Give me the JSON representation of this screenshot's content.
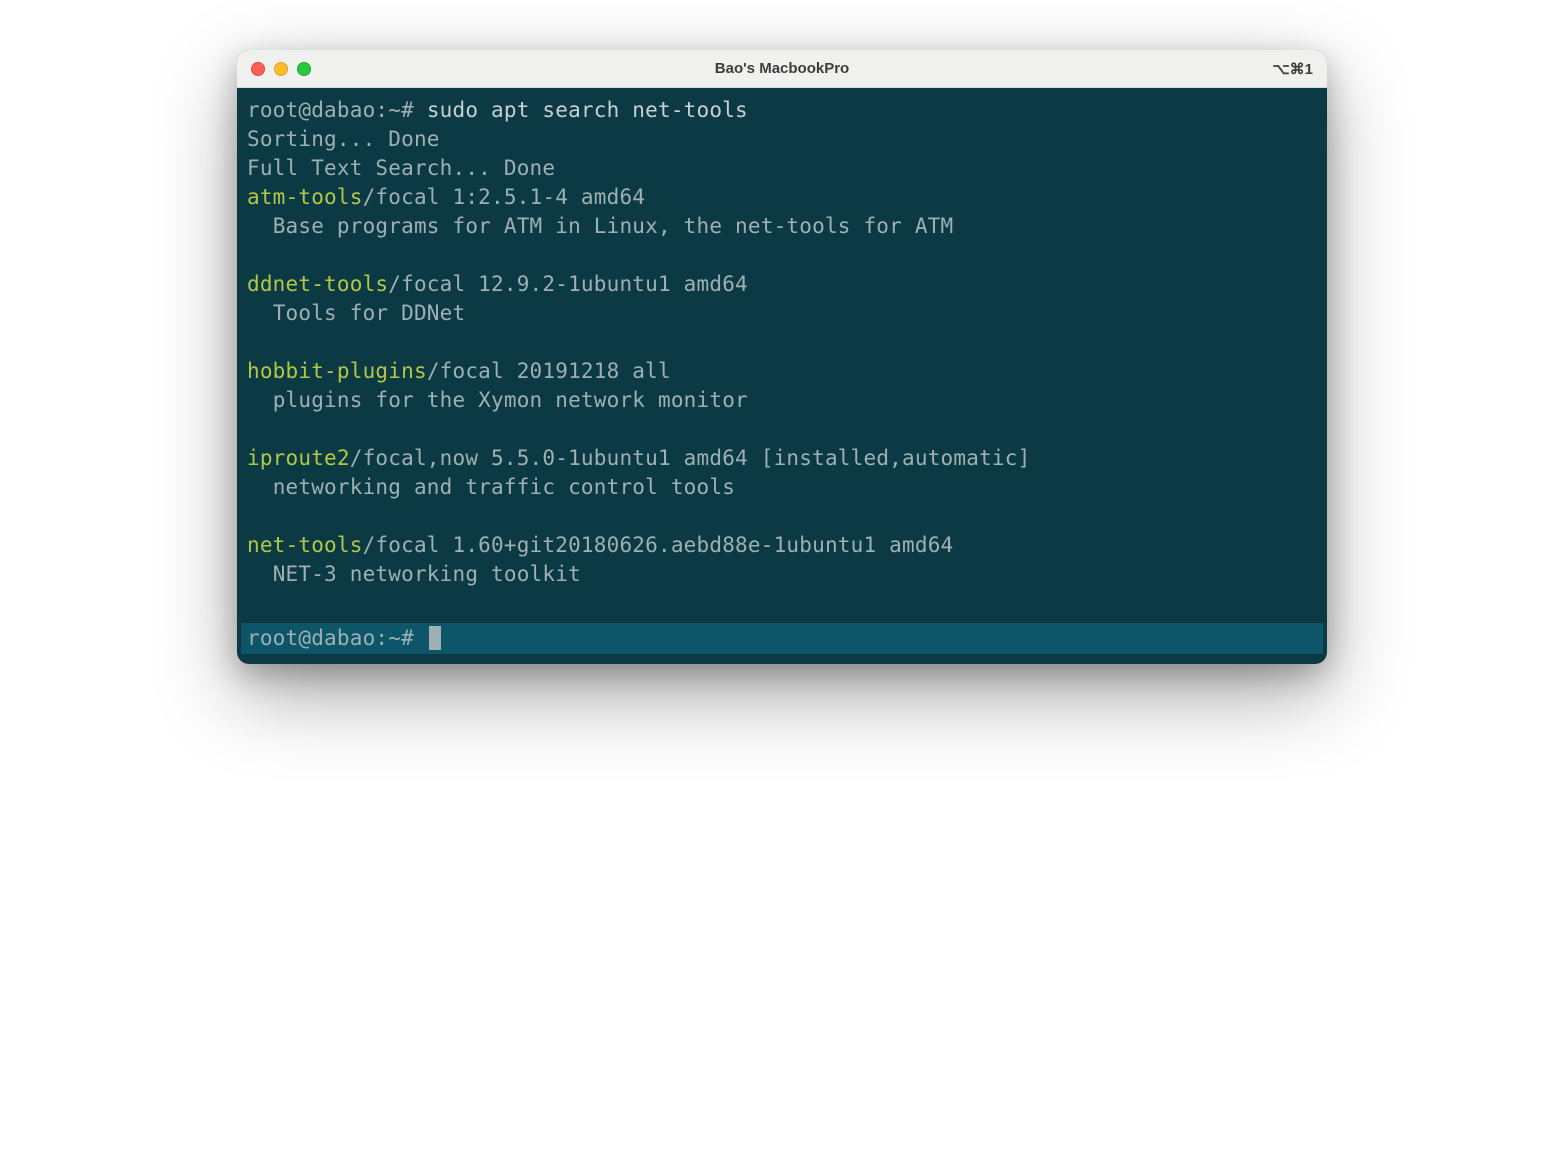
{
  "window": {
    "title": "Bao's MacbookPro",
    "shortcut": "⌥⌘1"
  },
  "terminal": {
    "prompt1": "root@dabao:~# ",
    "command1": "sudo apt search net-tools",
    "sorting": "Sorting... Done",
    "fulltext": "Full Text Search... Done",
    "packages": [
      {
        "name": "atm-tools",
        "meta": "/focal 1:2.5.1-4 amd64",
        "desc": "Base programs for ATM in Linux, the net-tools for ATM"
      },
      {
        "name": "ddnet-tools",
        "meta": "/focal 12.9.2-1ubuntu1 amd64",
        "desc": "Tools for DDNet"
      },
      {
        "name": "hobbit-plugins",
        "meta": "/focal 20191218 all",
        "desc": "plugins for the Xymon network monitor"
      },
      {
        "name": "iproute2",
        "meta": "/focal,now 5.5.0-1ubuntu1 amd64 [installed,automatic]",
        "desc": "networking and traffic control tools"
      },
      {
        "name": "net-tools",
        "meta": "/focal 1.60+git20180626.aebd88e-1ubuntu1 amd64",
        "desc": "NET-3 networking toolkit"
      }
    ],
    "prompt2": "root@dabao:~# "
  }
}
